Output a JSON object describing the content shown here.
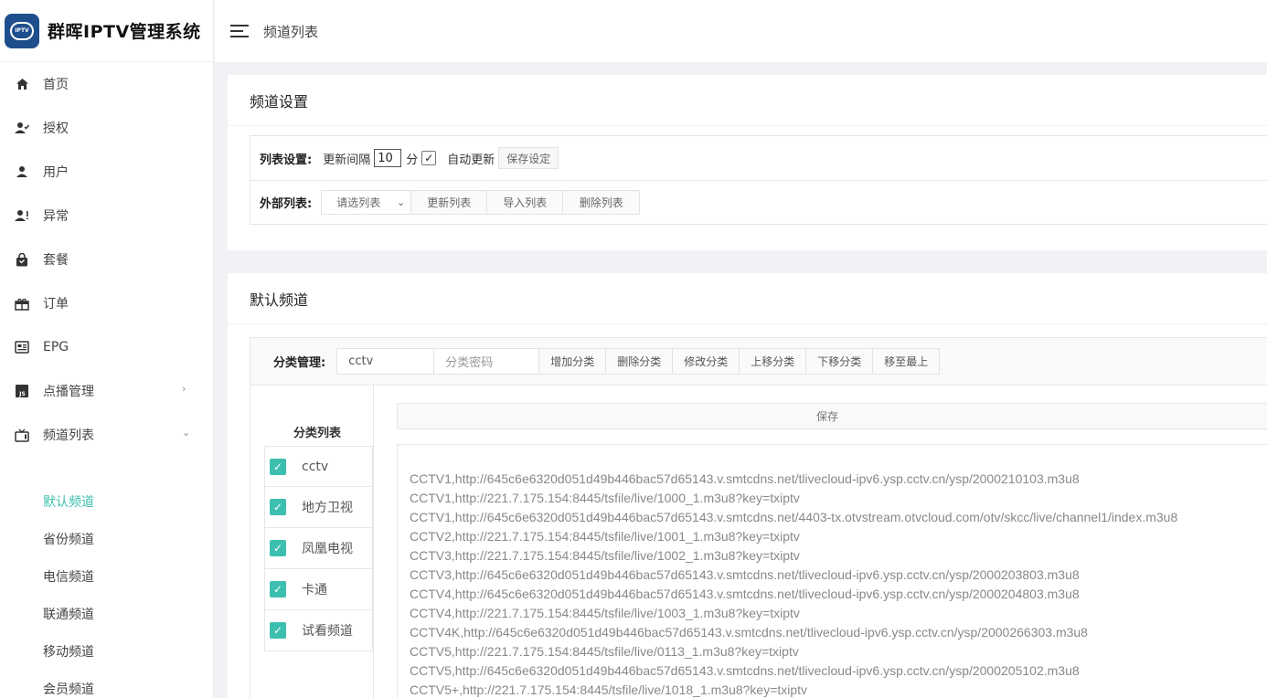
{
  "brand": {
    "title": "群晖IPTV管理系统",
    "logo_text": "IPTV"
  },
  "sidebar": {
    "items": [
      {
        "label": "首页",
        "icon": "home-icon"
      },
      {
        "label": "授权",
        "icon": "user-check-icon"
      },
      {
        "label": "用户",
        "icon": "user-icon"
      },
      {
        "label": "异常",
        "icon": "user-alert-icon"
      },
      {
        "label": "套餐",
        "icon": "bag-icon"
      },
      {
        "label": "订单",
        "icon": "gift-icon"
      },
      {
        "label": "EPG",
        "icon": "epg-icon"
      },
      {
        "label": "点播管理",
        "icon": "js-icon"
      },
      {
        "label": "频道列表",
        "icon": "tv-icon"
      }
    ],
    "sub_items": [
      "默认频道",
      "省份频道",
      "电信频道",
      "联通频道",
      "移动频道",
      "会员频道"
    ]
  },
  "topbar": {
    "breadcrumb": "频道列表"
  },
  "settings": {
    "title": "频道设置",
    "list_label": "列表设置:",
    "interval_label": "更新间隔",
    "interval_value": "10",
    "interval_unit": "分",
    "auto_update_label": "自动更新",
    "auto_update_checked": true,
    "save_label": "保存设定",
    "external_label": "外部列表:",
    "select_placeholder": "请选列表",
    "update_list": "更新列表",
    "import_list": "导入列表",
    "delete_list": "删除列表"
  },
  "default_channels": {
    "title": "默认频道",
    "cat_manage_label": "分类管理:",
    "cat_name_value": "cctv",
    "cat_password_placeholder": "分类密码",
    "buttons": {
      "add": "增加分类",
      "delete": "删除分类",
      "edit": "修改分类",
      "up": "上移分类",
      "down": "下移分类",
      "top": "移至最上"
    },
    "cat_list_title": "分类列表",
    "categories": [
      "cctv",
      "地方卫视",
      "凤凰电视",
      "卡通",
      "试看频道"
    ],
    "save_label": "保存",
    "lines": [
      "CCTV1,http://645c6e6320d051d49b446bac57d65143.v.smtcdns.net/tlivecloud-ipv6.ysp.cctv.cn/ysp/2000210103.m3u8",
      "CCTV1,http://221.7.175.154:8445/tsfile/live/1000_1.m3u8?key=txiptv",
      "CCTV1,http://645c6e6320d051d49b446bac57d65143.v.smtcdns.net/4403-tx.otvstream.otvcloud.com/otv/skcc/live/channel1/index.m3u8",
      "CCTV2,http://221.7.175.154:8445/tsfile/live/1001_1.m3u8?key=txiptv",
      "CCTV3,http://221.7.175.154:8445/tsfile/live/1002_1.m3u8?key=txiptv",
      "CCTV3,http://645c6e6320d051d49b446bac57d65143.v.smtcdns.net/tlivecloud-ipv6.ysp.cctv.cn/ysp/2000203803.m3u8",
      "CCTV4,http://645c6e6320d051d49b446bac57d65143.v.smtcdns.net/tlivecloud-ipv6.ysp.cctv.cn/ysp/2000204803.m3u8",
      "CCTV4,http://221.7.175.154:8445/tsfile/live/1003_1.m3u8?key=txiptv",
      "CCTV4K,http://645c6e6320d051d49b446bac57d65143.v.smtcdns.net/tlivecloud-ipv6.ysp.cctv.cn/ysp/2000266303.m3u8",
      "CCTV5,http://221.7.175.154:8445/tsfile/live/0113_1.m3u8?key=txiptv",
      "CCTV5,http://645c6e6320d051d49b446bac57d65143.v.smtcdns.net/tlivecloud-ipv6.ysp.cctv.cn/ysp/2000205102.m3u8",
      "CCTV5+,http://221.7.175.154:8445/tsfile/live/1018_1.m3u8?key=txiptv"
    ]
  },
  "colors": {
    "accent": "#3cbfae",
    "logo_bg": "#1f4e8c"
  }
}
